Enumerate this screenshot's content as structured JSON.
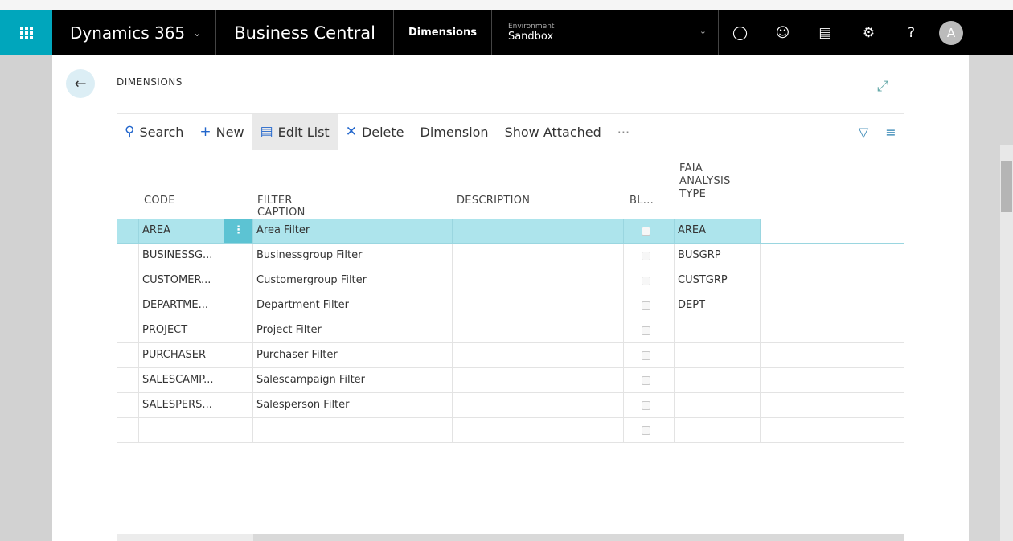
{
  "topbar": {
    "brand": "Dynamics 365",
    "app": "Business Central",
    "page": "Dimensions",
    "env_label": "Environment",
    "env_value": "Sandbox",
    "avatar_initial": "A"
  },
  "page": {
    "title": "DIMENSIONS"
  },
  "actions": {
    "search": "Search",
    "new": "New",
    "edit_list": "Edit List",
    "delete": "Delete",
    "dimension": "Dimension",
    "show_attached": "Show Attached",
    "more": "···"
  },
  "table": {
    "headers": {
      "code": "CODE",
      "filter_caption": "FILTER CAPTION",
      "description": "DESCRIPTION",
      "blocked": "BL...",
      "faia_line1": "FAIA",
      "faia_line2": "ANALYSIS",
      "faia_line3": "TYPE"
    },
    "rows": [
      {
        "code": "AREA",
        "filter_caption": "Area Filter",
        "description": "",
        "faia": "AREA"
      },
      {
        "code": "BUSINESSG...",
        "filter_caption": "Businessgroup Filter",
        "description": "",
        "faia": "BUSGRP"
      },
      {
        "code": "CUSTOMER...",
        "filter_caption": "Customergroup Filter",
        "description": "",
        "faia": "CUSTGRP"
      },
      {
        "code": "DEPARTME...",
        "filter_caption": "Department Filter",
        "description": "",
        "faia": "DEPT"
      },
      {
        "code": "PROJECT",
        "filter_caption": "Project Filter",
        "description": "",
        "faia": ""
      },
      {
        "code": "PURCHASER",
        "filter_caption": "Purchaser Filter",
        "description": "",
        "faia": ""
      },
      {
        "code": "SALESCAMP...",
        "filter_caption": "Salescampaign Filter",
        "description": "",
        "faia": ""
      },
      {
        "code": "SALESPERS...",
        "filter_caption": "Salesperson Filter",
        "description": "",
        "faia": ""
      },
      {
        "code": "",
        "filter_caption": "",
        "description": "",
        "faia": ""
      }
    ]
  },
  "colors": {
    "accent": "#00a6bc",
    "selected_row": "#ade4ec",
    "topbar": "#000000"
  }
}
